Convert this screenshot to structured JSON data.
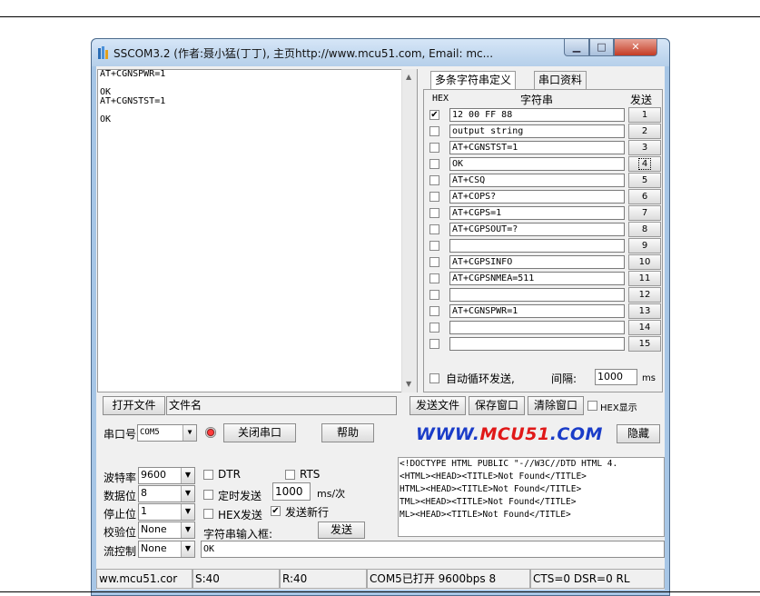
{
  "window": {
    "title": "SSCOM3.2 (作者:聂小猛(丁丁), 主页http://www.mcu51.com,  Email: mc..."
  },
  "receive": {
    "lines": [
      "AT+CGNSPWR=1",
      "",
      "OK",
      "AT+CGNSTST=1",
      "",
      "OK"
    ]
  },
  "tabs": [
    "多条字符串定义",
    "串口资料"
  ],
  "multi": {
    "col_hex": "HEX",
    "col_string": "字符串",
    "col_send": "发送",
    "rows": [
      {
        "checked": true,
        "text": "12 00 FF 88",
        "num": "1"
      },
      {
        "checked": false,
        "text": "output string",
        "num": "2"
      },
      {
        "checked": false,
        "text": "AT+CGNSTST=1",
        "num": "3"
      },
      {
        "checked": false,
        "text": "OK",
        "num": "4"
      },
      {
        "checked": false,
        "text": "AT+CSQ",
        "num": "5"
      },
      {
        "checked": false,
        "text": "AT+COPS?",
        "num": "6"
      },
      {
        "checked": false,
        "text": "AT+CGPS=1",
        "num": "7"
      },
      {
        "checked": false,
        "text": "AT+CGPSOUT=?",
        "num": "8"
      },
      {
        "checked": false,
        "text": "",
        "num": "9"
      },
      {
        "checked": false,
        "text": "AT+CGPSINFO",
        "num": "10"
      },
      {
        "checked": false,
        "text": "AT+CGPSNMEA=511",
        "num": "11"
      },
      {
        "checked": false,
        "text": "",
        "num": "12"
      },
      {
        "checked": false,
        "text": "AT+CGNSPWR=1",
        "num": "13"
      },
      {
        "checked": false,
        "text": "",
        "num": "14"
      },
      {
        "checked": false,
        "text": "",
        "num": "15"
      }
    ],
    "loop_label": "自动循环发送,",
    "interval_label": "间隔:",
    "interval_value": "1000",
    "interval_unit": "ms"
  },
  "file_row": {
    "open_file": "打开文件",
    "filename": "文件名",
    "send_file": "发送文件",
    "save_window": "保存窗口",
    "clear_window": "清除窗口",
    "hex_display": "HEX显示"
  },
  "port_row": {
    "port_label": "串口号",
    "port_value": "COM5",
    "close_port": "关闭串口",
    "help": "帮助",
    "logo_a": "WWW.",
    "logo_b": "MCU51",
    "logo_c": ".COM",
    "hide": "隐藏"
  },
  "settings": {
    "baud_label": "波特率",
    "baud_value": "9600",
    "data_label": "数据位",
    "data_value": "8",
    "stop_label": "停止位",
    "stop_value": "1",
    "parity_label": "校验位",
    "parity_value": "None",
    "flow_label": "流控制",
    "flow_value": "None",
    "dtr": "DTR",
    "rts": "RTS",
    "timed_send": "定时发送",
    "timed_value": "1000",
    "timed_unit": "ms/次",
    "hex_send": "HEX发送",
    "newline_send": "发送新行",
    "input_label": "字符串输入框:",
    "send_button": "发送",
    "input_value": "OK"
  },
  "html_lines": [
    "<!DOCTYPE HTML PUBLIC \"-//W3C//DTD HTML 4.",
    "<HTML><HEAD><TITLE>Not Found</TITLE>",
    "HTML><HEAD><TITLE>Not Found</TITLE>",
    "TML><HEAD><TITLE>Not Found</TITLE>",
    "ML><HEAD><TITLE>Not Found</TITLE>"
  ],
  "status": {
    "site": "ww.mcu51.cor",
    "sent": "S:40",
    "recv": "R:40",
    "port_state": "COM5已打开  9600bps  8",
    "lines": "CTS=0 DSR=0 RL"
  }
}
